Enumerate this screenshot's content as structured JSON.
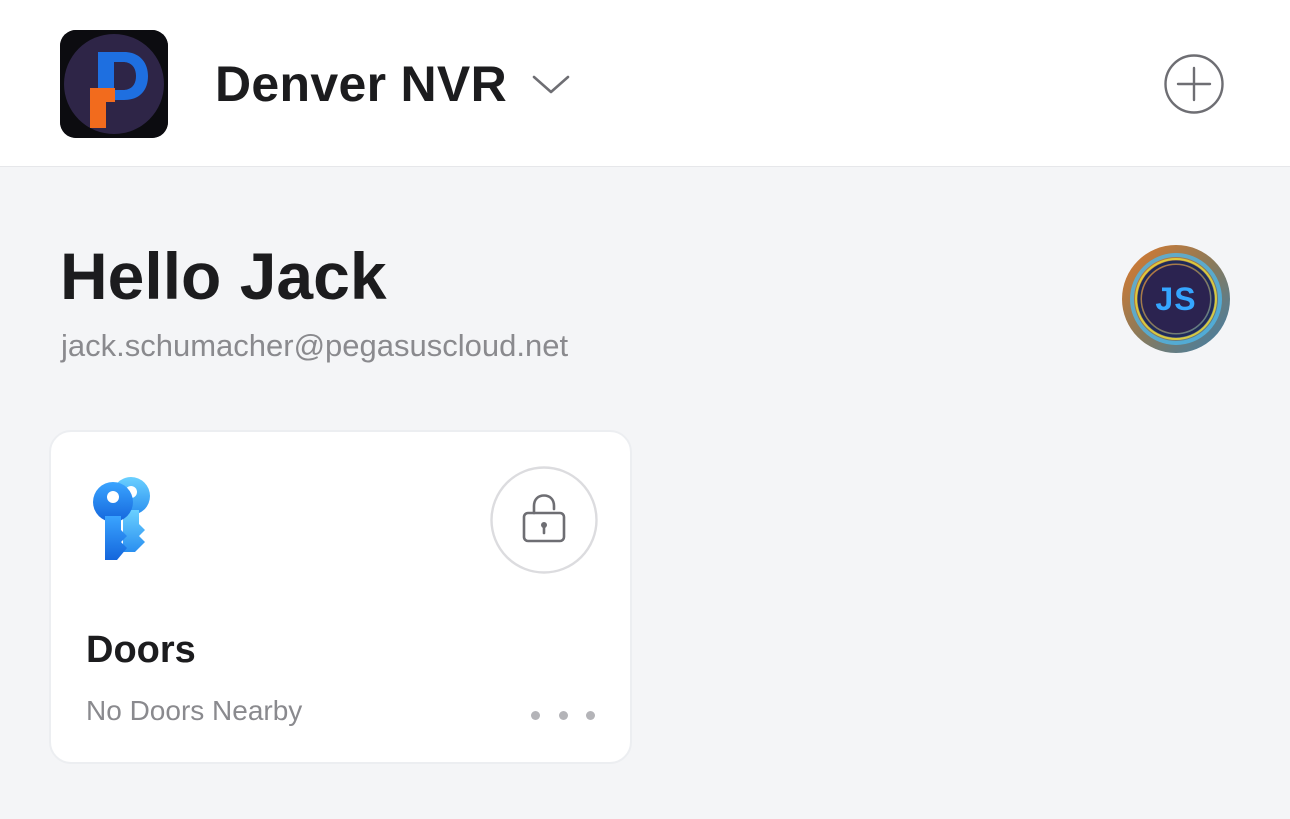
{
  "header": {
    "site_name": "Denver NVR",
    "logo_icon": "pegasus-p-logo-icon",
    "dropdown_icon": "chevron-down-icon",
    "add_icon": "plus-circle-icon"
  },
  "user": {
    "greeting": "Hello Jack",
    "email": "jack.schumacher@pegasuscloud.net",
    "initials": "JS"
  },
  "cards": [
    {
      "title": "Doors",
      "status": "No Doors Nearby",
      "icon": "keys-icon",
      "action_icon": "unlock-icon",
      "more_icon": "more-horizontal-icon"
    }
  ],
  "colors": {
    "background": "#f4f5f7",
    "surface": "#ffffff",
    "text_primary": "#1c1c1e",
    "text_secondary": "#8a8a8e",
    "accent_blue": "#2e8cf0",
    "brand_orange": "#f26b1d",
    "brand_blue": "#1e6fe0",
    "brand_purple": "#2e2547"
  }
}
